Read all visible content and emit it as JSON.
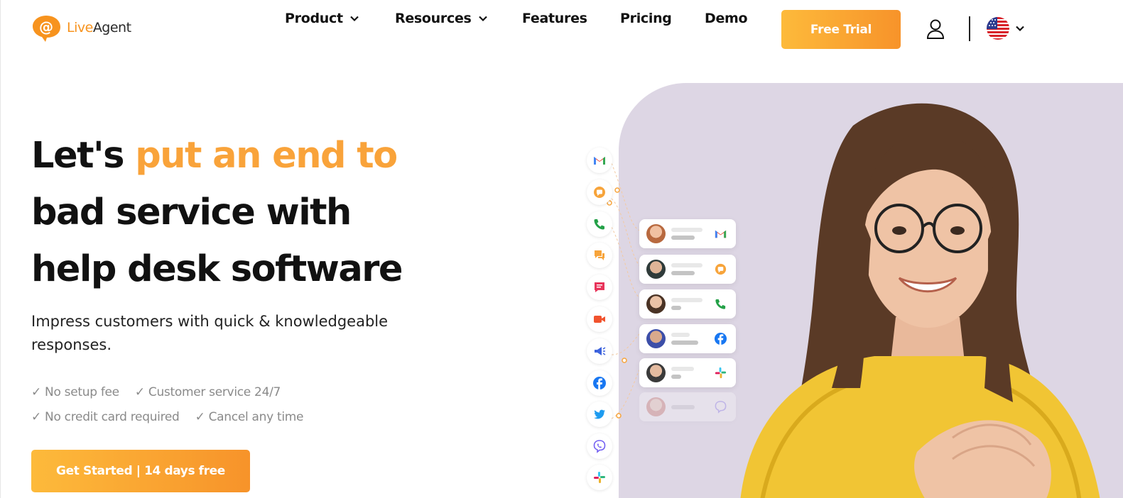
{
  "brand": {
    "name_part1": "Live",
    "name_part2": "Agent",
    "logo_icon": "speech-bubble-at-icon"
  },
  "nav": {
    "product": "Product",
    "resources": "Resources",
    "features": "Features",
    "pricing": "Pricing",
    "demo": "Demo",
    "free_trial": "Free Trial",
    "language": "en-US"
  },
  "hero": {
    "title_part1": "Let's ",
    "title_accent": "put an end to",
    "title_line2": "bad service with",
    "title_line3": "help desk software",
    "subtitle": "Impress customers with quick & knowledgeable responses.",
    "checks": [
      "✓ No setup fee",
      "✓ Customer service 24/7",
      "✓ No credit card required",
      "✓ Cancel any time"
    ],
    "cta": "Get Started | 14 days free"
  },
  "channels": [
    "gmail-icon",
    "chat-icon",
    "phone-icon",
    "messages-icon",
    "form-icon",
    "video-icon",
    "megaphone-icon",
    "facebook-icon",
    "twitter-icon",
    "viber-icon",
    "slack-icon"
  ],
  "tickets": [
    {
      "channel": "gmail-icon"
    },
    {
      "channel": "chat-icon"
    },
    {
      "channel": "phone-icon"
    },
    {
      "channel": "facebook-icon"
    },
    {
      "channel": "slack-icon"
    },
    {
      "channel": "viber-icon"
    }
  ],
  "colors": {
    "accent": "#f9a33a",
    "button_start": "#fdba3b",
    "button_end": "#f7932a",
    "hero_bg": "#ddd6e4"
  }
}
